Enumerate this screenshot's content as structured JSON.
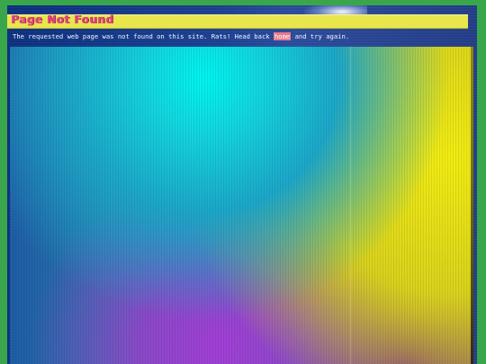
{
  "page": {
    "title": "Page Not Found",
    "message_before": "The requested web page was not found on this site. Rats! Head back ",
    "home_link_label": "home",
    "message_after": " and try again."
  },
  "colors": {
    "page_background": "#3aa64b",
    "title_bar": "#e9e64d",
    "title_text": "#e2467e",
    "link_highlight": "#e77a8e"
  }
}
